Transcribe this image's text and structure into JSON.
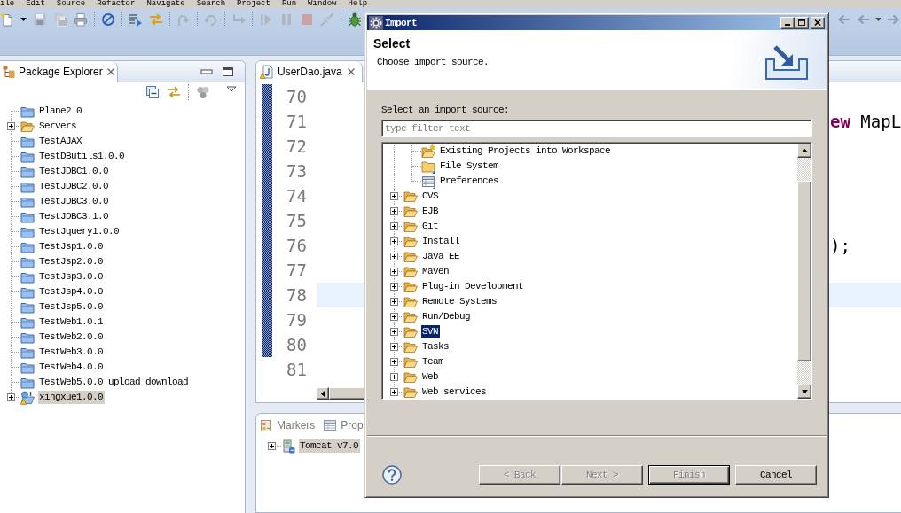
{
  "menu_bar": {
    "items": [
      "ile",
      "Edit",
      "Source",
      "Refactor",
      "Navigate",
      "Search",
      "Project",
      "Run",
      "Window",
      "Help"
    ]
  },
  "package_explorer": {
    "tab": {
      "label": "Package Explorer"
    },
    "items": [
      {
        "label": "Plane2.0",
        "kind": "project",
        "selected": false
      },
      {
        "label": "Servers",
        "kind": "folder",
        "expanded": false,
        "selected": false
      },
      {
        "label": "TestAJAX",
        "kind": "project",
        "selected": false
      },
      {
        "label": "TestDButils1.0.0",
        "kind": "project",
        "selected": false
      },
      {
        "label": "TestJDBC1.0.0",
        "kind": "project",
        "selected": false
      },
      {
        "label": "TestJDBC2.0.0",
        "kind": "project",
        "selected": false
      },
      {
        "label": "TestJDBC3.0.0",
        "kind": "project",
        "selected": false
      },
      {
        "label": "TestJDBC3.1.0",
        "kind": "project",
        "selected": false
      },
      {
        "label": "TestJquery1.0.0",
        "kind": "project",
        "selected": false
      },
      {
        "label": "TestJsp1.0.0",
        "kind": "project",
        "selected": false
      },
      {
        "label": "TestJsp2.0.0",
        "kind": "project",
        "selected": false
      },
      {
        "label": "TestJsp3.0.0",
        "kind": "project",
        "selected": false
      },
      {
        "label": "TestJsp4.0.0",
        "kind": "project",
        "selected": false
      },
      {
        "label": "TestJsp5.0.0",
        "kind": "project",
        "selected": false
      },
      {
        "label": "TestWeb1.0.1",
        "kind": "project",
        "selected": false
      },
      {
        "label": "TestWeb2.0.0",
        "kind": "project",
        "selected": false
      },
      {
        "label": "TestWeb3.0.0",
        "kind": "project",
        "selected": false
      },
      {
        "label": "TestWeb4.0.0",
        "kind": "project",
        "selected": false
      },
      {
        "label": "TestWeb5.0.0_upload_download",
        "kind": "project",
        "selected": false
      },
      {
        "label": "xingxue1.0.0",
        "kind": "web-project",
        "expanded": false,
        "selected": true
      }
    ]
  },
  "editor": {
    "tab": {
      "label": "UserDao.java"
    },
    "lines": [
      {
        "number": "70",
        "in_range": true,
        "current": false
      },
      {
        "number": "71",
        "in_range": true,
        "current": false,
        "code": [
          {
            "text": "ew",
            "kind": "keyword"
          },
          {
            "text": "MapL",
            "kind": "plain"
          }
        ]
      },
      {
        "number": "72",
        "in_range": true,
        "current": false
      },
      {
        "number": "73",
        "in_range": true,
        "current": false
      },
      {
        "number": "74",
        "in_range": true,
        "current": false
      },
      {
        "number": "75",
        "in_range": true,
        "current": false
      },
      {
        "number": "76",
        "in_range": true,
        "current": false,
        "code": [
          {
            "text": ");",
            "kind": "plain"
          }
        ]
      },
      {
        "number": "77",
        "in_range": true,
        "current": false
      },
      {
        "number": "78",
        "in_range": true,
        "current": true
      },
      {
        "number": "79",
        "in_range": true,
        "current": false
      },
      {
        "number": "80",
        "in_range": true,
        "current": false
      },
      {
        "number": "81",
        "in_range": false,
        "current": false
      }
    ]
  },
  "bottom_panel": {
    "tabs": [
      {
        "label": "Markers",
        "kind": "markers",
        "selected": false
      },
      {
        "label": "Prop",
        "kind": "properties",
        "selected": false
      }
    ],
    "items": [
      {
        "label": "Tomcat v7.0",
        "expanded": false,
        "selected": true
      }
    ]
  },
  "dialog": {
    "title": "Import",
    "header": {
      "title": "Select",
      "message": "Choose import source."
    },
    "source_label": "Select an import source:",
    "filter": {
      "placeholder": "type filter text"
    },
    "tree": {
      "items": [
        {
          "children": [
            {
              "label": "Existing Projects into Workspace",
              "kind": "projects",
              "selected": false
            },
            {
              "label": "File System",
              "kind": "file-system",
              "selected": false
            },
            {
              "label": "Preferences",
              "kind": "preferences",
              "selected": false
            }
          ]
        },
        {
          "label": "CVS",
          "expanded": false,
          "selected": false
        },
        {
          "label": "EJB",
          "expanded": false,
          "selected": false
        },
        {
          "label": "Git",
          "expanded": false,
          "selected": false
        },
        {
          "label": "Install",
          "expanded": false,
          "selected": false
        },
        {
          "label": "Java EE",
          "expanded": false,
          "selected": false
        },
        {
          "label": "Maven",
          "expanded": false,
          "selected": false
        },
        {
          "label": "Plug-in Development",
          "expanded": false,
          "selected": false
        },
        {
          "label": "Remote Systems",
          "expanded": false,
          "selected": false
        },
        {
          "label": "Run/Debug",
          "expanded": false,
          "selected": false
        },
        {
          "label": "SVN",
          "expanded": false,
          "selected": true
        },
        {
          "label": "Tasks",
          "expanded": false,
          "selected": false
        },
        {
          "label": "Team",
          "expanded": false,
          "selected": false
        },
        {
          "label": "Web",
          "expanded": false,
          "selected": false
        },
        {
          "label": "Web services",
          "expanded": false,
          "selected": false
        }
      ]
    },
    "buttons": [
      {
        "label": "< Back",
        "disabled": true,
        "default": false
      },
      {
        "label": "Next >",
        "disabled": true,
        "default": false
      },
      {
        "label": "Finish",
        "disabled": true,
        "default": true
      },
      {
        "label": "Cancel",
        "disabled": false,
        "default": false
      }
    ]
  }
}
